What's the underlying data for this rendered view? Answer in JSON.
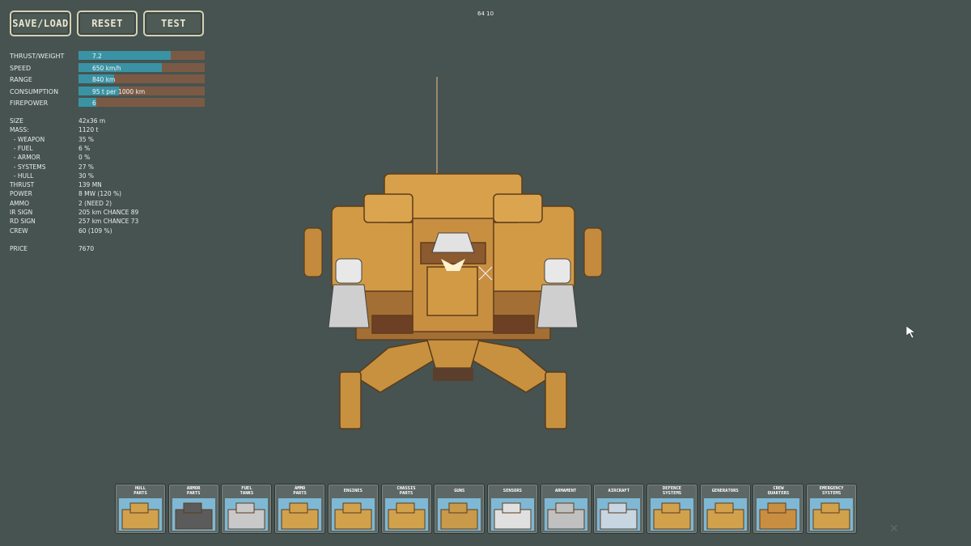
{
  "toolbar": {
    "save_load": "SAVE/LOAD",
    "reset": "RESET",
    "test": "TEST"
  },
  "fps": "64 10",
  "stats_bars": [
    {
      "label": "THRUST/WEIGHT",
      "value": "7.2",
      "fill": 0.73
    },
    {
      "label": "SPEED",
      "value": "650 km/h",
      "fill": 0.66
    },
    {
      "label": "RANGE",
      "value": "840 km",
      "fill": 0.28
    },
    {
      "label": "CONSUMPTION",
      "value": "95 t per 1000 km",
      "fill": 0.32
    },
    {
      "label": "FIREPOWER",
      "value": "6",
      "fill": 0.14
    }
  ],
  "info": [
    {
      "label": "SIZE",
      "value": "42x36 m"
    },
    {
      "label": "MASS:",
      "value": "1120 t"
    },
    {
      "label": "  - WEAPON",
      "value": "35 %"
    },
    {
      "label": "  - FUEL",
      "value": "6 %"
    },
    {
      "label": "  - ARMOR",
      "value": "0 %"
    },
    {
      "label": "  - SYSTEMS",
      "value": "27 %"
    },
    {
      "label": "  - HULL",
      "value": "30 %"
    },
    {
      "label": "THRUST",
      "value": "139 MN"
    },
    {
      "label": "POWER",
      "value": "8 MW (120 %)"
    },
    {
      "label": "AMMO",
      "value": "2 (NEED 2)"
    },
    {
      "label": "IR SIGN",
      "value": "205 km CHANCE 89"
    },
    {
      "label": "RD SIGN",
      "value": "257 km CHANCE 73"
    },
    {
      "label": "CREW",
      "value": "60 (109 %)"
    }
  ],
  "price": {
    "label": "PRICE",
    "value": "7670"
  },
  "parts": [
    {
      "line1": "HULL",
      "line2": "PARTS",
      "icon": "hull-parts-icon"
    },
    {
      "line1": "ARMOR",
      "line2": "PARTS",
      "icon": "armor-parts-icon"
    },
    {
      "line1": "FUEL",
      "line2": "TANKS",
      "icon": "fuel-tanks-icon"
    },
    {
      "line1": "AMMO",
      "line2": "PARTS",
      "icon": "ammo-parts-icon"
    },
    {
      "line1": "ENGINES",
      "line2": "",
      "icon": "engines-icon"
    },
    {
      "line1": "CHASSIS",
      "line2": "PARTS",
      "icon": "chassis-parts-icon"
    },
    {
      "line1": "GUNS",
      "line2": "",
      "icon": "guns-icon"
    },
    {
      "line1": "SENSORS",
      "line2": "",
      "icon": "sensors-icon"
    },
    {
      "line1": "ARMAMENT",
      "line2": "",
      "icon": "armament-icon"
    },
    {
      "line1": "AIRCRAFT",
      "line2": "",
      "icon": "aircraft-icon"
    },
    {
      "line1": "DEFENCE",
      "line2": "SYSTEMS",
      "icon": "defence-systems-icon"
    },
    {
      "line1": "GENERATORS",
      "line2": "",
      "icon": "generators-icon"
    },
    {
      "line1": "CREW",
      "line2": "QUARTERS",
      "icon": "crew-quarters-icon"
    },
    {
      "line1": "EMERGENCY",
      "line2": "SYSTEMS",
      "icon": "emergency-systems-icon"
    }
  ],
  "colors": {
    "background": "#465350",
    "bar_fill": "#3a93a4",
    "bar_bg": "#7b5a45",
    "ship": "#d39a45"
  }
}
